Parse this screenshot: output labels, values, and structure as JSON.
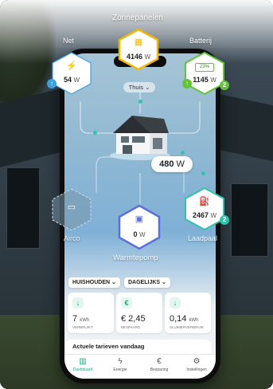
{
  "top_labels": {
    "solar": "Zonnepanelen",
    "grid": "Net",
    "battery": "Batterij"
  },
  "nodes": {
    "grid": {
      "value": "54",
      "unit": "W",
      "icon": "power-pylon-icon",
      "badge_icon": "arrow-up-icon",
      "color": "#3aa0e0"
    },
    "solar": {
      "value": "4146",
      "unit": "W",
      "icon": "solar-panel-icon",
      "color": "#f2b705"
    },
    "battery": {
      "value": "1145",
      "unit": "W",
      "battery_level": "23%",
      "badge": "2",
      "color": "#63c23a"
    },
    "airco": {
      "label": "Airco",
      "icon": "air-conditioner-icon"
    },
    "heatpump": {
      "label": "Warmtepomp",
      "value": "0",
      "unit": "W",
      "icon": "heat-pump-icon",
      "color": "#5b6fd8"
    },
    "charger": {
      "label": "Laadpaal",
      "value": "2467",
      "unit": "W",
      "badge": "2",
      "icon": "ev-charger-icon",
      "color": "#2fc4a8"
    }
  },
  "home": {
    "selector": "Thuis",
    "power_value": "480",
    "power_unit": "W"
  },
  "filters": {
    "household": "HUISHOUDEN",
    "period": "DAGELIJKS"
  },
  "stats": [
    {
      "icon": "arrow-down-icon",
      "value": "7",
      "unit": "kWh",
      "label": "VERBRUIKT"
    },
    {
      "icon": "euro-icon",
      "value": "€ 2,45",
      "unit": "",
      "label": "BESPAARD"
    },
    {
      "icon": "arrow-down-icon",
      "value": "0,14",
      "unit": "kWh",
      "label": "SLUIMERVERBRUIK"
    }
  ],
  "tariffs": {
    "title": "Actuele tarieven vandaag"
  },
  "tabs": [
    {
      "label": "Dashboard",
      "icon": "bar-chart-icon",
      "active": true
    },
    {
      "label": "Energie",
      "icon": "lightning-icon",
      "active": false
    },
    {
      "label": "Besparing",
      "icon": "euro-icon",
      "active": false
    },
    {
      "label": "Instellingen",
      "icon": "gear-icon",
      "active": false
    }
  ],
  "colors": {
    "accent": "#2fc4a8",
    "tab_active": "#1aa57a"
  }
}
